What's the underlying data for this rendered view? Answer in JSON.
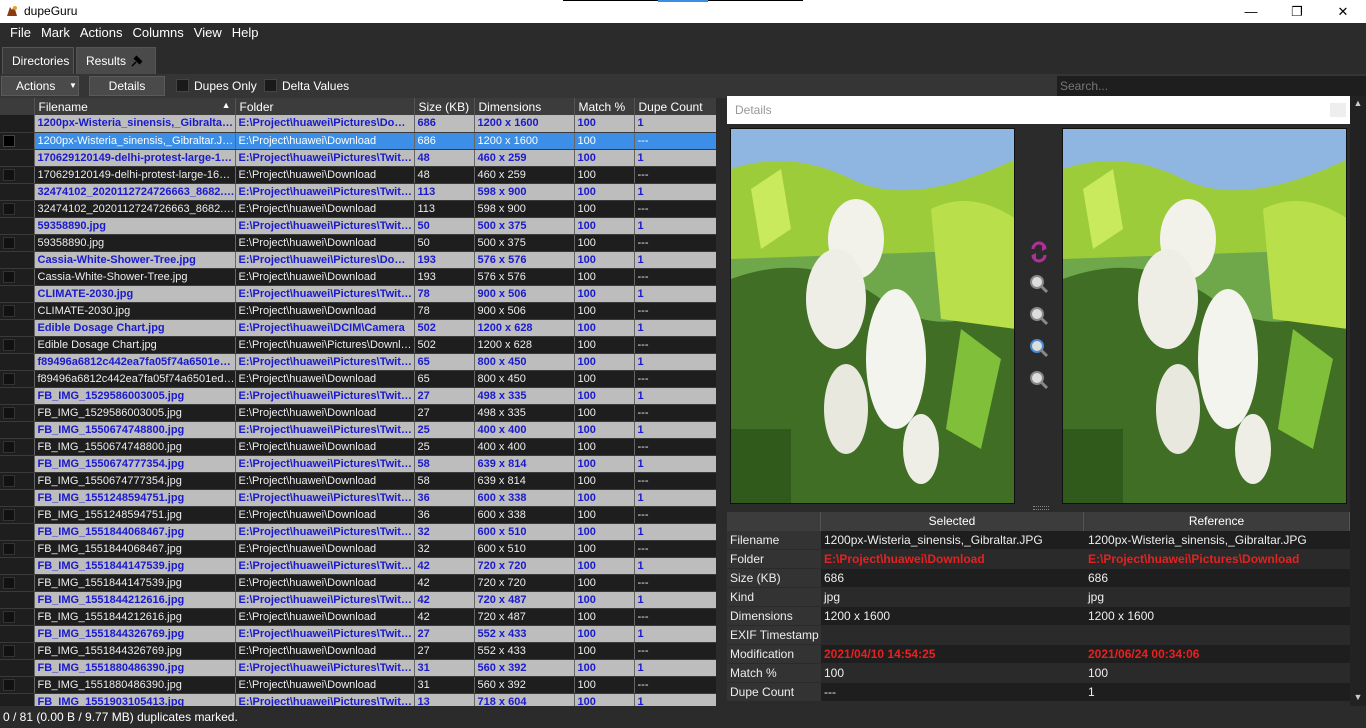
{
  "window": {
    "title": "dupeGuru"
  },
  "menu": [
    "File",
    "Mark",
    "Actions",
    "Columns",
    "View",
    "Help"
  ],
  "tabs": {
    "directories": "Directories",
    "results": "Results"
  },
  "toolbar": {
    "actions_label": "Actions",
    "details_label": "Details",
    "dupes_only_label": "Dupes Only",
    "delta_values_label": "Delta Values",
    "search_placeholder": "Search..."
  },
  "results": {
    "columns": [
      "Filename",
      "Folder",
      "Size (KB)",
      "Dimensions",
      "Match %",
      "Dupe Count"
    ],
    "rows": [
      {
        "type": "ref",
        "filename": "1200px-Wisteria_sinensis,_Gibraltar.JPG",
        "folder": "E:\\Project\\huawei\\Pictures\\Download",
        "size": "686",
        "dims": "1200 x 1600",
        "match": "100",
        "count": "1"
      },
      {
        "type": "sel",
        "filename": "1200px-Wisteria_sinensis,_Gibraltar.JPG",
        "folder": "E:\\Project\\huawei\\Download",
        "size": "686",
        "dims": "1200 x 1600",
        "match": "100",
        "count": "---"
      },
      {
        "type": "ref",
        "filename": "170629120149-delhi-protest-large-169.jpg",
        "folder": "E:\\Project\\huawei\\Pictures\\Twitter",
        "size": "48",
        "dims": "460 x 259",
        "match": "100",
        "count": "1"
      },
      {
        "type": "dup",
        "filename": "170629120149-delhi-protest-large-169.jpg",
        "folder": "E:\\Project\\huawei\\Download",
        "size": "48",
        "dims": "460 x 259",
        "match": "100",
        "count": "---"
      },
      {
        "type": "ref",
        "filename": "32474102_2020112724726663_8682.jpg",
        "folder": "E:\\Project\\huawei\\Pictures\\Twitter",
        "size": "113",
        "dims": "598 x 900",
        "match": "100",
        "count": "1"
      },
      {
        "type": "dup",
        "filename": "32474102_2020112724726663_8682.jpg",
        "folder": "E:\\Project\\huawei\\Download",
        "size": "113",
        "dims": "598 x 900",
        "match": "100",
        "count": "---"
      },
      {
        "type": "ref",
        "filename": "59358890.jpg",
        "folder": "E:\\Project\\huawei\\Pictures\\Twitter",
        "size": "50",
        "dims": "500 x 375",
        "match": "100",
        "count": "1"
      },
      {
        "type": "dup",
        "filename": "59358890.jpg",
        "folder": "E:\\Project\\huawei\\Download",
        "size": "50",
        "dims": "500 x 375",
        "match": "100",
        "count": "---"
      },
      {
        "type": "ref",
        "filename": "Cassia-White-Shower-Tree.jpg",
        "folder": "E:\\Project\\huawei\\Pictures\\Download",
        "size": "193",
        "dims": "576 x 576",
        "match": "100",
        "count": "1"
      },
      {
        "type": "dup",
        "filename": "Cassia-White-Shower-Tree.jpg",
        "folder": "E:\\Project\\huawei\\Download",
        "size": "193",
        "dims": "576 x 576",
        "match": "100",
        "count": "---"
      },
      {
        "type": "ref",
        "filename": "CLIMATE-2030.jpg",
        "folder": "E:\\Project\\huawei\\Pictures\\Twitter",
        "size": "78",
        "dims": "900 x 506",
        "match": "100",
        "count": "1"
      },
      {
        "type": "dup",
        "filename": "CLIMATE-2030.jpg",
        "folder": "E:\\Project\\huawei\\Download",
        "size": "78",
        "dims": "900 x 506",
        "match": "100",
        "count": "---"
      },
      {
        "type": "ref",
        "filename": "Edible Dosage Chart.jpg",
        "folder": "E:\\Project\\huawei\\DCIM\\Camera",
        "size": "502",
        "dims": "1200 x 628",
        "match": "100",
        "count": "1"
      },
      {
        "type": "dup",
        "filename": "Edible Dosage Chart.jpg",
        "folder": "E:\\Project\\huawei\\Pictures\\Download",
        "size": "502",
        "dims": "1200 x 628",
        "match": "100",
        "count": "---"
      },
      {
        "type": "ref",
        "filename": "f89496a6812c442ea7fa05f74a6501ed.jpg",
        "folder": "E:\\Project\\huawei\\Pictures\\Twitter",
        "size": "65",
        "dims": "800 x 450",
        "match": "100",
        "count": "1"
      },
      {
        "type": "dup",
        "filename": "f89496a6812c442ea7fa05f74a6501ed.jpg",
        "folder": "E:\\Project\\huawei\\Download",
        "size": "65",
        "dims": "800 x 450",
        "match": "100",
        "count": "---"
      },
      {
        "type": "ref",
        "filename": "FB_IMG_1529586003005.jpg",
        "folder": "E:\\Project\\huawei\\Pictures\\Twitter",
        "size": "27",
        "dims": "498 x 335",
        "match": "100",
        "count": "1"
      },
      {
        "type": "dup",
        "filename": "FB_IMG_1529586003005.jpg",
        "folder": "E:\\Project\\huawei\\Download",
        "size": "27",
        "dims": "498 x 335",
        "match": "100",
        "count": "---"
      },
      {
        "type": "ref",
        "filename": "FB_IMG_1550674748800.jpg",
        "folder": "E:\\Project\\huawei\\Pictures\\Twitter",
        "size": "25",
        "dims": "400 x 400",
        "match": "100",
        "count": "1"
      },
      {
        "type": "dup",
        "filename": "FB_IMG_1550674748800.jpg",
        "folder": "E:\\Project\\huawei\\Download",
        "size": "25",
        "dims": "400 x 400",
        "match": "100",
        "count": "---"
      },
      {
        "type": "ref",
        "filename": "FB_IMG_1550674777354.jpg",
        "folder": "E:\\Project\\huawei\\Pictures\\Twitter",
        "size": "58",
        "dims": "639 x 814",
        "match": "100",
        "count": "1"
      },
      {
        "type": "dup",
        "filename": "FB_IMG_1550674777354.jpg",
        "folder": "E:\\Project\\huawei\\Download",
        "size": "58",
        "dims": "639 x 814",
        "match": "100",
        "count": "---"
      },
      {
        "type": "ref",
        "filename": "FB_IMG_1551248594751.jpg",
        "folder": "E:\\Project\\huawei\\Pictures\\Twitter",
        "size": "36",
        "dims": "600 x 338",
        "match": "100",
        "count": "1"
      },
      {
        "type": "dup",
        "filename": "FB_IMG_1551248594751.jpg",
        "folder": "E:\\Project\\huawei\\Download",
        "size": "36",
        "dims": "600 x 338",
        "match": "100",
        "count": "---"
      },
      {
        "type": "ref",
        "filename": "FB_IMG_1551844068467.jpg",
        "folder": "E:\\Project\\huawei\\Pictures\\Twitter",
        "size": "32",
        "dims": "600 x 510",
        "match": "100",
        "count": "1"
      },
      {
        "type": "dup",
        "filename": "FB_IMG_1551844068467.jpg",
        "folder": "E:\\Project\\huawei\\Download",
        "size": "32",
        "dims": "600 x 510",
        "match": "100",
        "count": "---"
      },
      {
        "type": "ref",
        "filename": "FB_IMG_1551844147539.jpg",
        "folder": "E:\\Project\\huawei\\Pictures\\Twitter",
        "size": "42",
        "dims": "720 x 720",
        "match": "100",
        "count": "1"
      },
      {
        "type": "dup",
        "filename": "FB_IMG_1551844147539.jpg",
        "folder": "E:\\Project\\huawei\\Download",
        "size": "42",
        "dims": "720 x 720",
        "match": "100",
        "count": "---"
      },
      {
        "type": "ref",
        "filename": "FB_IMG_1551844212616.jpg",
        "folder": "E:\\Project\\huawei\\Pictures\\Twitter",
        "size": "42",
        "dims": "720 x 487",
        "match": "100",
        "count": "1"
      },
      {
        "type": "dup",
        "filename": "FB_IMG_1551844212616.jpg",
        "folder": "E:\\Project\\huawei\\Download",
        "size": "42",
        "dims": "720 x 487",
        "match": "100",
        "count": "---"
      },
      {
        "type": "ref",
        "filename": "FB_IMG_1551844326769.jpg",
        "folder": "E:\\Project\\huawei\\Pictures\\Twitter",
        "size": "27",
        "dims": "552 x 433",
        "match": "100",
        "count": "1"
      },
      {
        "type": "dup",
        "filename": "FB_IMG_1551844326769.jpg",
        "folder": "E:\\Project\\huawei\\Download",
        "size": "27",
        "dims": "552 x 433",
        "match": "100",
        "count": "---"
      },
      {
        "type": "ref",
        "filename": "FB_IMG_1551880486390.jpg",
        "folder": "E:\\Project\\huawei\\Pictures\\Twitter",
        "size": "31",
        "dims": "560 x 392",
        "match": "100",
        "count": "1"
      },
      {
        "type": "dup",
        "filename": "FB_IMG_1551880486390.jpg",
        "folder": "E:\\Project\\huawei\\Download",
        "size": "31",
        "dims": "560 x 392",
        "match": "100",
        "count": "---"
      },
      {
        "type": "ref",
        "filename": "FB_IMG_1551903105413.jpg",
        "folder": "E:\\Project\\huawei\\Pictures\\Twitter",
        "size": "13",
        "dims": "718 x 604",
        "match": "100",
        "count": "1"
      }
    ]
  },
  "details": {
    "title": "Details",
    "headers": {
      "selected": "Selected",
      "reference": "Reference"
    },
    "rows": [
      {
        "label": "Filename",
        "selected": "1200px-Wisteria_sinensis,_Gibraltar.JPG",
        "reference": "1200px-Wisteria_sinensis,_Gibraltar.JPG",
        "diff": false
      },
      {
        "label": "Folder",
        "selected": "E:\\Project\\huawei\\Download",
        "reference": "E:\\Project\\huawei\\Pictures\\Download",
        "diff": true
      },
      {
        "label": "Size (KB)",
        "selected": "686",
        "reference": "686",
        "diff": false
      },
      {
        "label": "Kind",
        "selected": "jpg",
        "reference": "jpg",
        "diff": false
      },
      {
        "label": "Dimensions",
        "selected": "1200 x 1600",
        "reference": "1200 x 1600",
        "diff": false
      },
      {
        "label": "EXIF Timestamp",
        "selected": "",
        "reference": "",
        "diff": false
      },
      {
        "label": "Modification",
        "selected": "2021/04/10 14:54:25",
        "reference": "2021/06/24 00:34:06",
        "diff": true
      },
      {
        "label": "Match %",
        "selected": "100",
        "reference": "100",
        "diff": false
      },
      {
        "label": "Dupe Count",
        "selected": "---",
        "reference": "1",
        "diff": false
      }
    ]
  },
  "status": {
    "text": "0 / 81 (0.00 B / 9.77 MB) duplicates marked."
  },
  "colors": {
    "reference_text": "#1a1acc",
    "selection": "#3d8ee6",
    "diff_red": "#e82020",
    "zoom_accent": "#b0309a"
  },
  "icons": [
    "app-icon",
    "minimize-icon",
    "maximize-icon",
    "close-icon",
    "pin-icon",
    "dropdown-arrow-icon",
    "sort-arrow-icon",
    "swap-icon",
    "zoom-in-icon",
    "zoom-out-icon",
    "zoom-normal-icon",
    "zoom-best-fit-icon"
  ]
}
